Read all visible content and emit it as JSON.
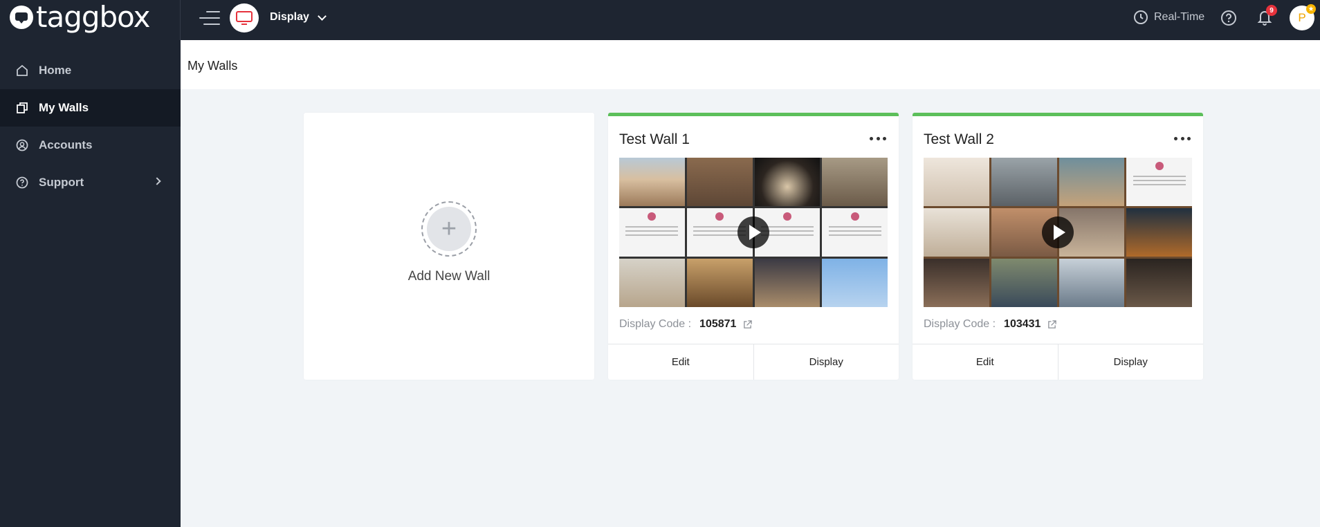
{
  "brand": {
    "logo_text": "taggbox"
  },
  "topbar": {
    "product_label": "Display",
    "realtime_label": "Real-Time",
    "notification_count": "9",
    "avatar_initial": "P",
    "accent_color": "#e6323c"
  },
  "sidebar": {
    "items": [
      {
        "label": "Home",
        "icon": "home-icon",
        "active": false
      },
      {
        "label": "My Walls",
        "icon": "walls-icon",
        "active": true
      },
      {
        "label": "Accounts",
        "icon": "account-icon",
        "active": false
      },
      {
        "label": "Support",
        "icon": "help-icon",
        "active": false,
        "has_submenu": true
      }
    ]
  },
  "page": {
    "title": "My Walls"
  },
  "add_card": {
    "label": "Add New Wall",
    "icon": "plus-icon"
  },
  "walls": [
    {
      "title": "Test Wall 1",
      "code_label": "Display Code :",
      "code": "105871",
      "edit_label": "Edit",
      "display_label": "Display",
      "accent": "#5cbf5a"
    },
    {
      "title": "Test Wall 2",
      "code_label": "Display Code :",
      "code": "103431",
      "edit_label": "Edit",
      "display_label": "Display",
      "accent": "#5cbf5a"
    }
  ]
}
